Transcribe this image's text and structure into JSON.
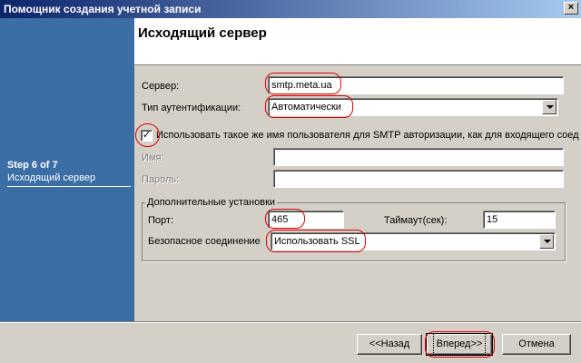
{
  "window": {
    "title": "Помощник создания учетной записи",
    "close_label": "×"
  },
  "sidebar": {
    "step_title": "Step 6 of 7",
    "step_subtitle": "Исходящий сервер"
  },
  "header": {
    "title": "Исходящий сервер"
  },
  "form": {
    "server_label": "Сервер:",
    "server_value": "smtp.meta.ua",
    "auth_label": "Тип аутентификации:",
    "auth_value": "Автоматически",
    "same_user_checked": true,
    "same_user_checkmark": "✓",
    "same_user_label": "Использовать такое же имя пользователя для SMTP авторизации, как для входящего соед",
    "name_label": "Имя:",
    "name_value": "",
    "password_label": "Пароль:",
    "password_value": ""
  },
  "advanced": {
    "legend": "Дополнительные установки",
    "port_label": "Порт:",
    "port_value": "465",
    "timeout_label": "Таймаут(сек):",
    "timeout_value": "15",
    "security_label": "Безопасное соединение",
    "security_value": "Использовать SSL"
  },
  "footer": {
    "back_label": "<<Назад",
    "next_label": "Вперед>>",
    "cancel_label": "Отмена"
  },
  "colors": {
    "sidebar_bg": "#3a6ea5",
    "highlight": "#e00000",
    "titlebar_start": "#0a246a",
    "titlebar_end": "#a6caf0"
  }
}
